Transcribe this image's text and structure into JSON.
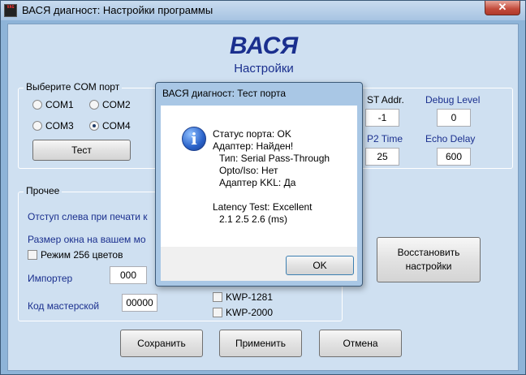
{
  "window": {
    "title": "ВАСЯ диагност: Настройки программы",
    "app_icon_text": "VAG",
    "close_glyph": "✕"
  },
  "header": {
    "brand": "ВАСЯ",
    "subtitle": "Настройки"
  },
  "com_group": {
    "label": "Выберите COM порт",
    "ports": [
      {
        "label": "COM1",
        "selected": false
      },
      {
        "label": "COM2",
        "selected": false
      },
      {
        "label": "COM3",
        "selected": false
      },
      {
        "label": "COM4",
        "selected": true
      }
    ],
    "test_button": "Тест"
  },
  "protocol": {
    "st_addr_label": "ST Addr.",
    "st_addr_value": "-1",
    "debug_level_label": "Debug Level",
    "debug_level_value": "0",
    "p2_time_label": "P2 Time",
    "p2_time_value": "25",
    "echo_delay_label": "Echo Delay",
    "echo_delay_value": "600"
  },
  "other_group": {
    "label": "Прочее",
    "print_offset_label": "Отступ слева при печати к",
    "window_size_label": "Размер окна на вашем мо",
    "mode256_label": "Режим 256 цветов",
    "importer_label": "Импортер",
    "importer_value": "000",
    "workshop_label": "Код мастерской",
    "workshop_value": "00000",
    "kwp1281_label": "KWP-1281",
    "kwp2000_label": "KWP-2000"
  },
  "restore_button": "Восстановить настройки",
  "footer": {
    "save": "Сохранить",
    "apply": "Применить",
    "cancel": "Отмена"
  },
  "dialog": {
    "title": "ВАСЯ диагност: Тест порта",
    "lines": [
      "Статус порта: OK",
      "Адаптер: Найден!",
      "  Тип: Serial Pass-Through",
      "  Opto/Iso: Нет",
      "  Адаптер KKL: Да",
      "",
      "Latency Test: Excellent",
      "  2.1  2.5  2.6 (ms)"
    ],
    "ok_button": "OK",
    "icon_glyph": "i"
  }
}
